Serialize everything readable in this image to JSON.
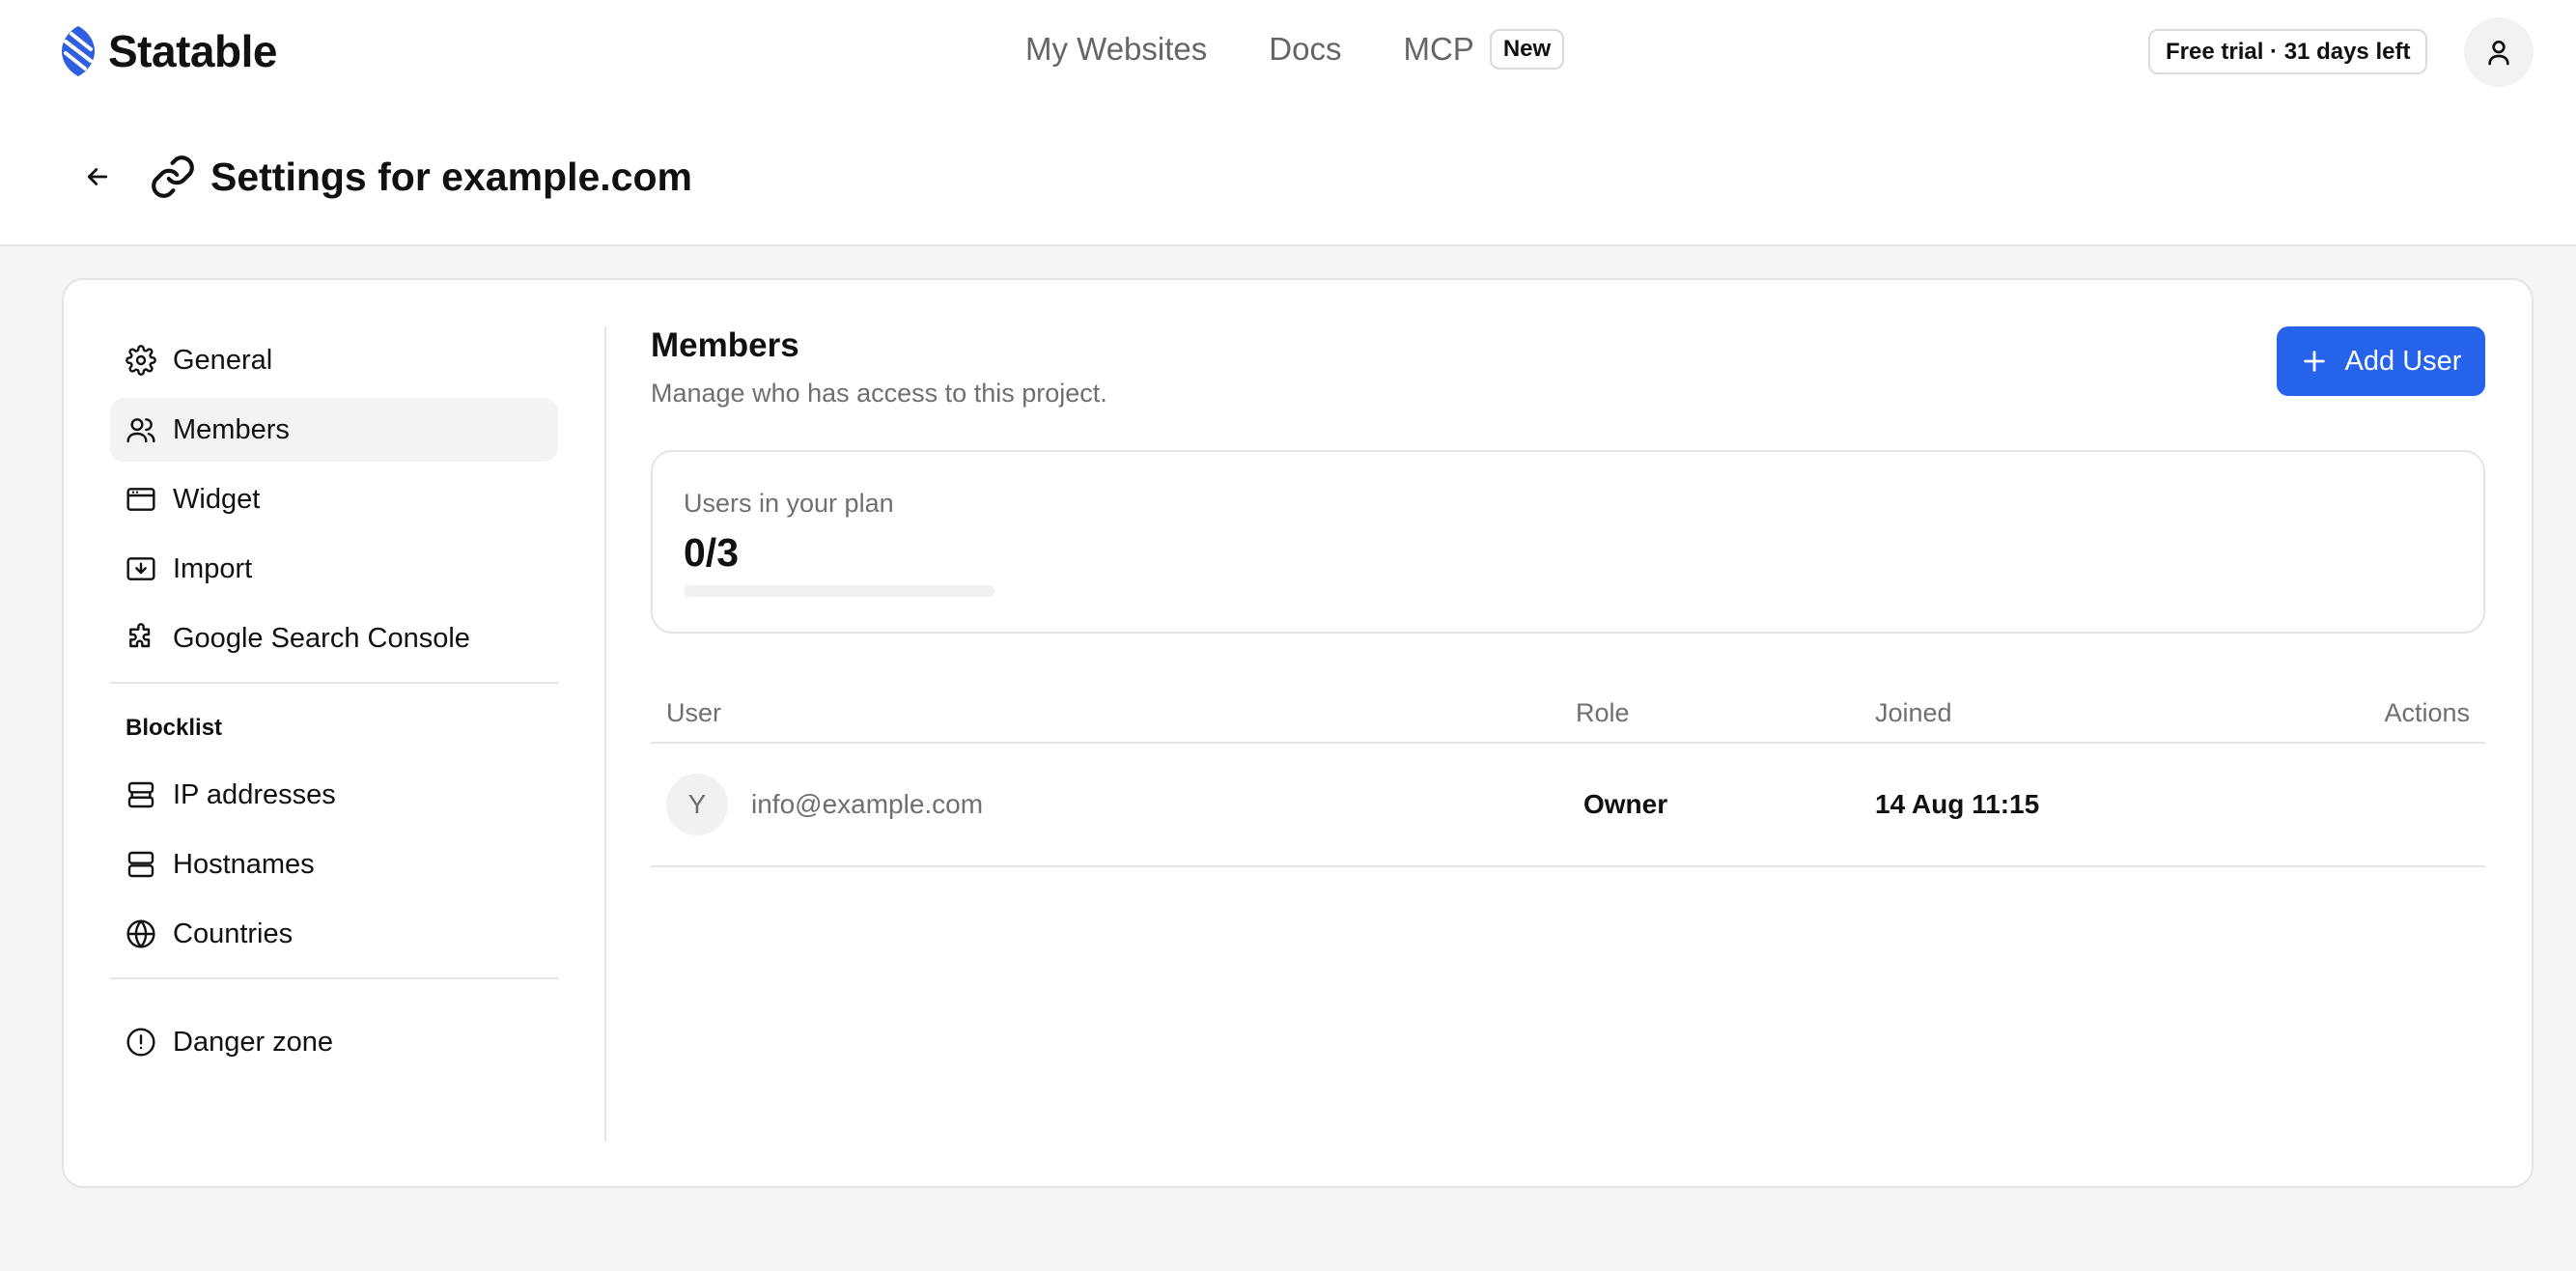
{
  "header": {
    "brand": "Statable",
    "nav": [
      {
        "label": "My Websites"
      },
      {
        "label": "Docs"
      },
      {
        "label": "MCP",
        "badge": "New"
      }
    ],
    "trial": "Free trial · 31 days left",
    "account_icon": "user-icon"
  },
  "page": {
    "title": "Settings for example.com",
    "back_icon": "arrow-left-icon",
    "title_icon": "link-icon"
  },
  "sidebar": {
    "items": [
      {
        "label": "General",
        "icon": "gear-icon"
      },
      {
        "label": "Members",
        "icon": "users-icon",
        "active": true
      },
      {
        "label": "Widget",
        "icon": "browser-window-icon"
      },
      {
        "label": "Import",
        "icon": "import-icon"
      },
      {
        "label": "Google Search Console",
        "icon": "puzzle-icon"
      }
    ],
    "blocklist_heading": "Blocklist",
    "blocklist": [
      {
        "label": "IP addresses",
        "icon": "server-icon"
      },
      {
        "label": "Hostnames",
        "icon": "server-stack-icon"
      },
      {
        "label": "Countries",
        "icon": "globe-icon"
      }
    ],
    "danger": {
      "label": "Danger zone",
      "icon": "alert-circle-icon"
    }
  },
  "members": {
    "title": "Members",
    "subtitle": "Manage who has access to this project.",
    "add_button": "Add User",
    "plan": {
      "label": "Users in your plan",
      "count": "0/3",
      "progress": 0
    },
    "table": {
      "headers": {
        "user": "User",
        "role": "Role",
        "joined": "Joined",
        "actions": "Actions"
      },
      "rows": [
        {
          "avatar": "Y",
          "email": "info@example.com",
          "role": "Owner",
          "joined": "14 Aug 11:15"
        }
      ]
    }
  },
  "colors": {
    "accent": "#2563eb",
    "brand": "#2f5fe0"
  }
}
